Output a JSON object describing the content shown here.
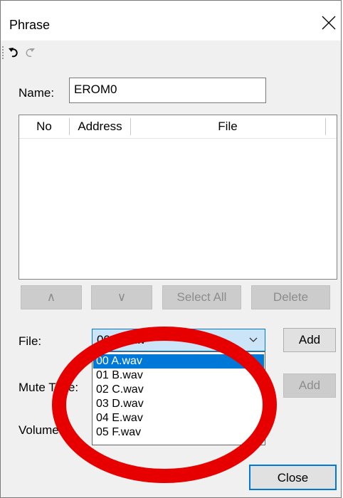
{
  "window": {
    "title": "Phrase"
  },
  "form": {
    "name_label": "Name:",
    "name_value": "EROM0",
    "file_label": "File:",
    "mute_time_label": "Mute Time:",
    "volume_label": "Volume:"
  },
  "list": {
    "columns": [
      "No",
      "Address",
      "File"
    ]
  },
  "buttons": {
    "up": "∧",
    "down": "∨",
    "select_all": "Select All",
    "delete": "Delete",
    "add_file": "Add",
    "add_mute": "Add",
    "close": "Close"
  },
  "file_combo": {
    "selected": "00 A.wav",
    "options": [
      "00 A.wav",
      "01 B.wav",
      "02 C.wav",
      "03 D.wav",
      "04 E.wav",
      "05 F.wav"
    ]
  },
  "icons": {
    "close": "close-icon",
    "undo": "undo-icon",
    "redo": "redo-icon",
    "dropdown": "chevron-down-icon"
  },
  "colors": {
    "selection": "#0078d7",
    "combo_focus": "#cce4f7",
    "annotation": "#e60000"
  }
}
